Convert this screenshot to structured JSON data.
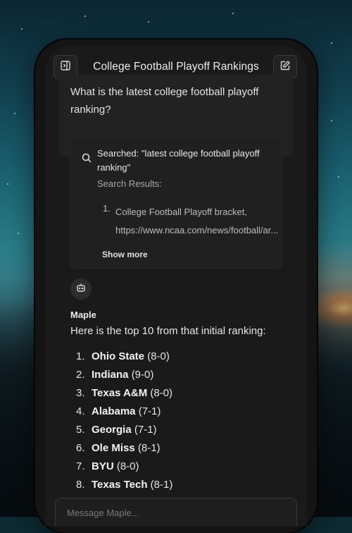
{
  "header": {
    "title": "College Football Playoff Rankings",
    "left_icon": "sidebar-toggle-icon",
    "right_icon": "new-chat-icon"
  },
  "user_message": "What is the latest college football playoff ranking?",
  "search": {
    "icon": "search-icon",
    "title": "Searched: \"latest college football playoff ranking\"",
    "results_label": "Search Results:",
    "results": [
      {
        "number": "1.",
        "text": "College Football Playoff bracket, https://www.ncaa.com/news/football/ar..."
      }
    ],
    "show_more": "Show more"
  },
  "assistant": {
    "avatar_icon": "bot-icon",
    "name": "Maple",
    "intro": "Here is the top 10 from that initial ranking:",
    "rankings": [
      {
        "number": "1.",
        "team": "Ohio State",
        "record": "(8-0)"
      },
      {
        "number": "2.",
        "team": "Indiana",
        "record": "(9-0)"
      },
      {
        "number": "3.",
        "team": "Texas A&M",
        "record": "(8-0)"
      },
      {
        "number": "4.",
        "team": "Alabama",
        "record": "(7-1)"
      },
      {
        "number": "5.",
        "team": "Georgia",
        "record": "(7-1)"
      },
      {
        "number": "6.",
        "team": "Ole Miss",
        "record": "(8-1)"
      },
      {
        "number": "7.",
        "team": "BYU",
        "record": "(8-0)"
      },
      {
        "number": "8.",
        "team": "Texas Tech",
        "record": "(8-1)"
      }
    ]
  },
  "composer": {
    "placeholder": "Message Maple..."
  }
}
